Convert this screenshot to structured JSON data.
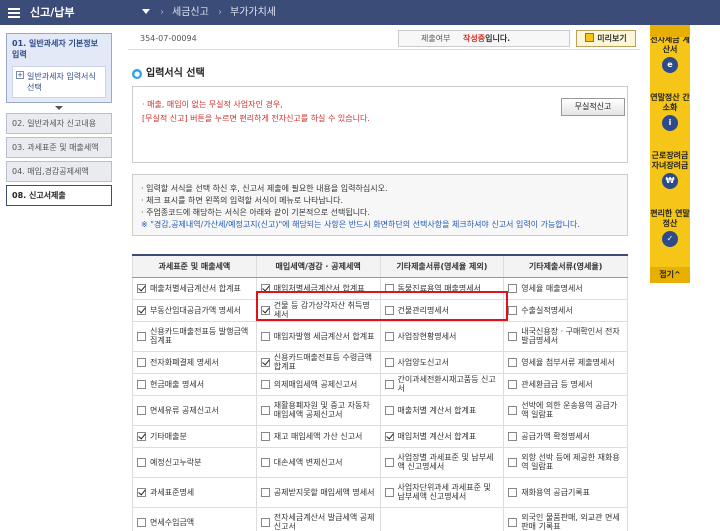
{
  "topnav": {
    "title": "신고/납부",
    "crumbs": [
      "세금신고",
      "부가가치세"
    ]
  },
  "steps": {
    "step1": "01. 일반과세자 기본정보 입력",
    "step1_sub": "일반과세자 입력서식 선택",
    "step2": "02. 일반과세자 신고내용",
    "step3": "03. 과세표준 및 매출세액",
    "step4": "04. 매입,경감공제세액",
    "step8": "08. 신고서제출"
  },
  "header": {
    "bizno": "354-07-00094",
    "status_label": "제출여부",
    "status_value": "작성중",
    "status_suffix": "입니다.",
    "preview_button": "미리보기"
  },
  "section": {
    "title": "입력서식 선택",
    "bullet": "●"
  },
  "notice": {
    "line1": "· 매출, 매입이 없는 무실적 사업자인 경우,",
    "line2": "[무실적 신고] 버튼을 누르면 편리하게 전자신고를 하실 수 있습니다.",
    "button": "무실적신고"
  },
  "guide": {
    "lines": [
      "· 입력할 서식을 선택 하신 후, 신고서 제출에 필요한 내용을 입력하십시오.",
      "· 체크 표시를 하면 왼쪽의 입력할 서식이 메뉴로 나타납니다.",
      "· 주업종코드에 해당하는 서식은 아래와 같이 기본적으로 선택됩니다.",
      "※ \"경감,공제내역/가산세/예정고지(신고)\"에 해당되는 사항은 반드시 화면하단의 선택사항을 체크하셔야 신고서 입력이 가능합니다."
    ]
  },
  "table": {
    "headers": [
      "과세표준 및 매출세액",
      "매입세액/경감 · 공제세액",
      "기타제출서류(영세율 제외)",
      "기타제출서류(영세율)"
    ],
    "rows": [
      [
        {
          "label": "매출처별세금계산서 합계표",
          "checked": true
        },
        {
          "label": "매입처별세금계산서 합계표",
          "checked": true
        },
        {
          "label": "동물진료용역 매출명세서",
          "checked": false
        },
        {
          "label": "영세율 매출명세서",
          "checked": false
        }
      ],
      [
        {
          "label": "부동산임대공급가액 명세서",
          "checked": true
        },
        {
          "label": "건물 등 감가상각자산 취득명세서",
          "checked": true
        },
        {
          "label": "건물관리명세서",
          "checked": false
        },
        {
          "label": "수출실적명세서",
          "checked": false
        }
      ],
      [
        {
          "label": "신용카드매출전표등 발행금액 집계표",
          "checked": false
        },
        {
          "label": "매입자발행 세금계산서 합계표",
          "checked": false
        },
        {
          "label": "사업장현황명세서",
          "checked": false
        },
        {
          "label": "내국신용장 · 구매확인서 전자발급명세서",
          "checked": false
        }
      ],
      [
        {
          "label": "전자화폐결제 명세서",
          "checked": false
        },
        {
          "label": "신용카드매출전표등 수령금액 합계표",
          "checked": true
        },
        {
          "label": "사업양도신고서",
          "checked": false
        },
        {
          "label": "영세율 첨부서류 제출명세서",
          "checked": false
        }
      ],
      [
        {
          "label": "현금매출 명세서",
          "checked": false
        },
        {
          "label": "의제매입세액 공제신고서",
          "checked": false
        },
        {
          "label": "간이과세전환시재고품등 신고서",
          "checked": false
        },
        {
          "label": "관세환급금 등 명세서",
          "checked": false
        }
      ],
      [
        {
          "label": "면세유류 공제신고서",
          "checked": false
        },
        {
          "label": "재활용폐자원 및 중고 자동차 매입세액 공제신고서",
          "checked": false
        },
        {
          "label": "매출처별 계산서 합계표",
          "checked": false
        },
        {
          "label": "선박에 의한 운송용역 공급가액 일람표",
          "checked": false
        }
      ],
      [
        {
          "label": "기타매출분",
          "checked": true
        },
        {
          "label": "재고 매입세액 가산 신고서",
          "checked": false
        },
        {
          "label": "매입처별 계산서 합계표",
          "checked": true
        },
        {
          "label": "공급가액 확정명세서",
          "checked": false
        }
      ],
      [
        {
          "label": "예정신고누락분",
          "checked": false
        },
        {
          "label": "대손세액 변제신고서",
          "checked": false
        },
        {
          "label": "사업장별 과세표준 및 납부세액 신고명세서",
          "checked": false
        },
        {
          "label": "외항 선박 등에 제공한 재화용역 일람표",
          "checked": false
        }
      ],
      [
        {
          "label": "과세표준명세",
          "checked": true
        },
        {
          "label": "공제받지못할 매입세액 명세서",
          "checked": false
        },
        {
          "label": "사업자단위과세 과세표준 및 납부세액 신고명세서",
          "checked": false
        },
        {
          "label": "재화용역 공급기록표",
          "checked": false
        }
      ],
      [
        {
          "label": "면세수입금액",
          "checked": false
        },
        {
          "label": "전자세금계산서 발급세액 공제신고서",
          "checked": false
        },
        {
          "label": "",
          "checked": false
        },
        {
          "label": "외국인 물품판매, 외교관 면세판매 기록표",
          "checked": false
        }
      ]
    ]
  },
  "rightbar": {
    "items": [
      {
        "label": "전자세금 계산서",
        "icon": "e"
      },
      {
        "label": "연말정산 간소화",
        "icon": "i"
      },
      {
        "label": "근로장려금 자녀장려금",
        "icon": "₩"
      },
      {
        "label": "편리한 연말정산",
        "icon": "✓"
      }
    ],
    "close_label": "접기",
    "close_icon": "^"
  }
}
